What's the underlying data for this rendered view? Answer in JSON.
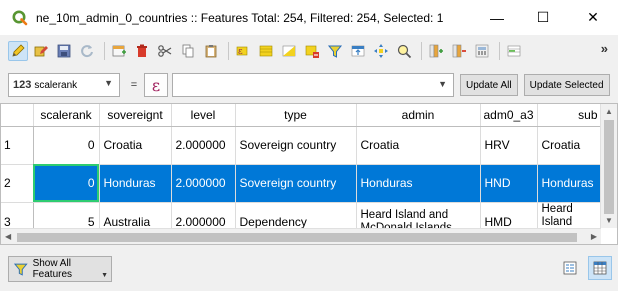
{
  "window": {
    "title": "ne_10m_admin_0_countries :: Features Total: 254, Filtered: 254, Selected: 1",
    "minimize_glyph": "—",
    "maximize_glyph": "☐",
    "close_glyph": "✕"
  },
  "toolbar": {
    "more_glyph": "»",
    "buttons": [
      "toggle-editing-icon",
      "multi-edit-icon",
      "save-edits-icon",
      "reload-icon",
      "add-feature-icon",
      "delete-feature-icon",
      "cut-icon",
      "copy-icon",
      "paste-icon",
      "select-by-expression-icon",
      "select-all-icon",
      "invert-selection-icon",
      "deselect-all-icon",
      "filter-selection-icon",
      "move-selection-to-top-icon",
      "pan-to-selection-icon",
      "zoom-to-selection-icon",
      "new-field-icon",
      "delete-field-icon",
      "field-calculator-icon",
      "conditional-formatting-icon"
    ]
  },
  "expression_bar": {
    "field_type_badge": "123",
    "field_name": "scalerank",
    "operator": "=",
    "expression_glyph": "ε",
    "expression_value": "",
    "update_all_label": "Update All",
    "update_selected_label": "Update Selected"
  },
  "table": {
    "columns": [
      "scalerank",
      "sovereignt",
      "level",
      "type",
      "admin",
      "adm0_a3",
      "sub"
    ],
    "rows": [
      {
        "id": "1",
        "scalerank": "0",
        "sovereignt": "Croatia",
        "level": "2.000000",
        "type": "Sovereign country",
        "admin": "Croatia",
        "adm0_a3": "HRV",
        "sub": "Croatia"
      },
      {
        "id": "2",
        "scalerank": "0",
        "sovereignt": "Honduras",
        "level": "2.000000",
        "type": "Sovereign country",
        "admin": "Honduras",
        "adm0_a3": "HND",
        "sub": "Honduras"
      },
      {
        "id": "3",
        "scalerank": "5",
        "sovereignt": "Australia",
        "level": "2.000000",
        "type": "Dependency",
        "admin": "Heard Island and McDonald Islands",
        "adm0_a3": "HMD",
        "sub": "Heard Island McDonald"
      }
    ],
    "selected_row": "2"
  },
  "bottom": {
    "show_all_label": "Show All Features"
  },
  "colors": {
    "selection": "#0078d7",
    "current_cell_outline": "#2ecc71",
    "qgis_green": "#589632"
  }
}
